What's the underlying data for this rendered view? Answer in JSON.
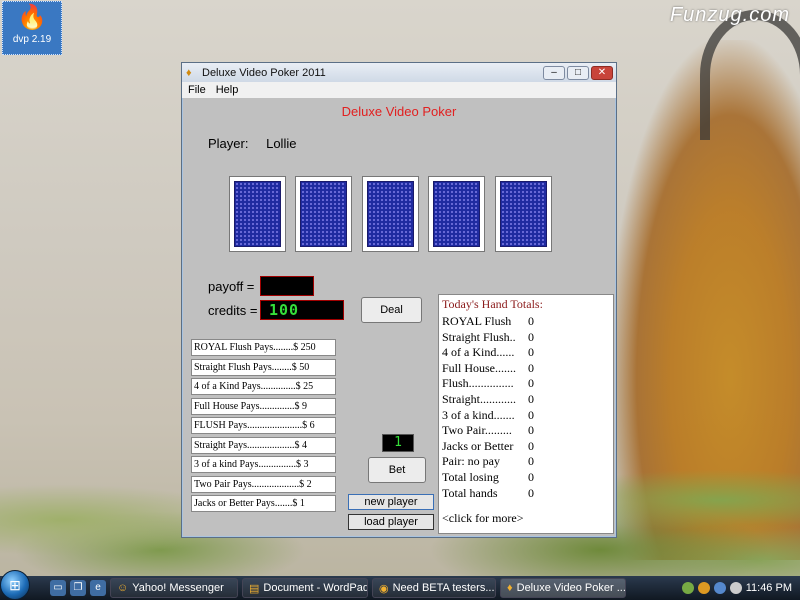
{
  "desktop": {
    "watermark": "Funzug.com",
    "icon_label": "dvp 2.19",
    "icon_glyph": "🔥"
  },
  "window": {
    "title": "Deluxe Video Poker 2011",
    "menu": [
      "File",
      "Help"
    ],
    "controls": {
      "minimize": "–",
      "maximize": "□",
      "close": "✕"
    }
  },
  "game": {
    "title": "Deluxe Video Poker",
    "player_label": "Player:",
    "player_name": "Lollie",
    "payoff_label": "payoff  =",
    "credits_label": "credits =",
    "credits_value": "100",
    "deal_label": "Deal",
    "bet_value": "1",
    "bet_label": "Bet",
    "new_player_label": "new player",
    "load_player_label": "load player",
    "cards": 5
  },
  "paytable": [
    "ROYAL Flush Pays........$ 250",
    "Straight Flush Pays........$  50",
    "4 of a Kind Pays..............$  25",
    "Full House Pays..............$   9",
    "FLUSH Pays......................$   6",
    "Straight Pays...................$   4",
    "3 of a kind Pays...............$   3",
    "Two Pair Pays...................$   2",
    "Jacks or Better Pays.......$   1"
  ],
  "totals": {
    "header": "Today's Hand Totals:",
    "rows": [
      {
        "label": "ROYAL Flush",
        "value": "0"
      },
      {
        "label": "Straight Flush..",
        "value": "0"
      },
      {
        "label": "4 of a Kind......",
        "value": "0"
      },
      {
        "label": "Full House.......",
        "value": "0"
      },
      {
        "label": "Flush...............",
        "value": "0"
      },
      {
        "label": "Straight............",
        "value": "0"
      },
      {
        "label": "3 of a kind.......",
        "value": "0"
      },
      {
        "label": "Two Pair.........",
        "value": "0"
      },
      {
        "label": "Jacks or Better",
        "value": "0"
      },
      {
        "label": "Pair: no pay",
        "value": "0"
      },
      {
        "label": "Total losing",
        "value": "0"
      },
      {
        "label": "Total hands",
        "value": "0"
      }
    ],
    "more": "<click for more>"
  },
  "taskbar": {
    "tasks": [
      {
        "label": "Yahoo! Messenger",
        "icon": "☺"
      },
      {
        "label": "Document - WordPad",
        "icon": "▤"
      },
      {
        "label": "Need BETA testers......",
        "icon": "◉"
      },
      {
        "label": "Deluxe Video Poker ...",
        "icon": "♦"
      }
    ],
    "clock": "11:46 PM"
  }
}
